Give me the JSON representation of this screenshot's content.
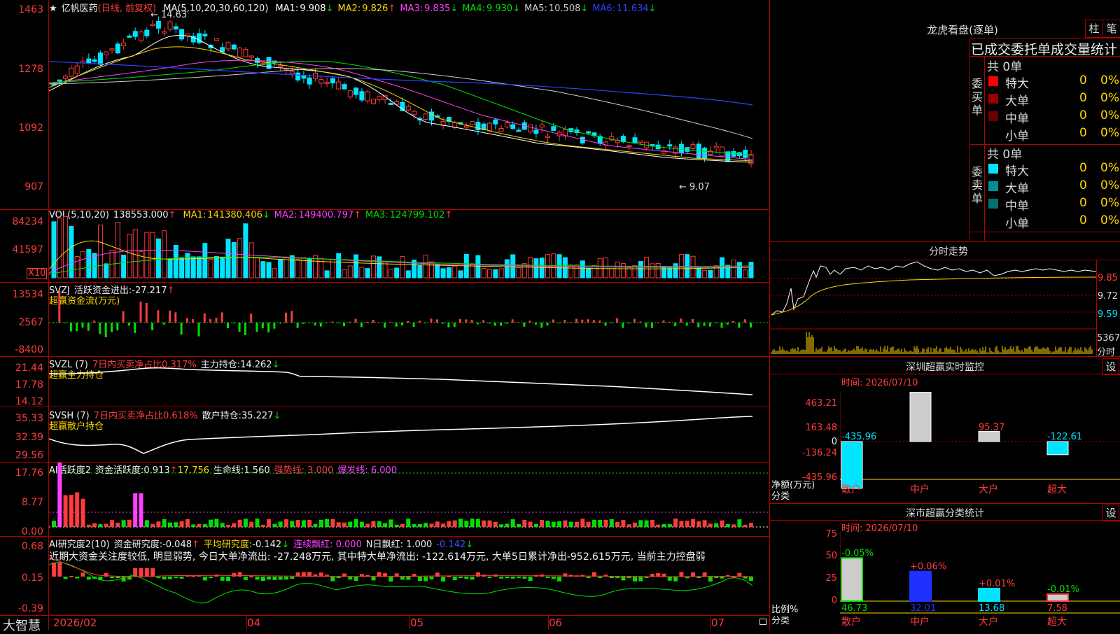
{
  "main": {
    "star": "★",
    "stock_name": "亿帆医药",
    "period": "(日线, 前复权)",
    "ma_label": "MA(5,10,20,30,60,120)",
    "ma": [
      {
        "label": "MA1:",
        "value": "9.908",
        "arrow": "↓",
        "color": "#ffffff"
      },
      {
        "label": "MA2:",
        "value": "9.826",
        "arrow": "↑",
        "color": "#ffd800"
      },
      {
        "label": "MA3:",
        "value": "9.835",
        "arrow": "↓",
        "color": "#ff40ff"
      },
      {
        "label": "MA4:",
        "value": "9.930",
        "arrow": "↓",
        "color": "#00e000"
      },
      {
        "label": "MA5:",
        "value": "10.508",
        "arrow": "↓",
        "color": "#cccccc"
      },
      {
        "label": "MA6:",
        "value": "11.634",
        "arrow": "↓",
        "color": "#3040ff"
      }
    ],
    "y_ticks": [
      "1463",
      "1278",
      "1092",
      "907"
    ],
    "high_label": "14.63",
    "low_label": "9.07"
  },
  "vol": {
    "label": "VOL(5,10,20)",
    "value": "138553.000",
    "value_arrow": "↑",
    "ma": [
      {
        "label": "MA1:",
        "value": "141380.406",
        "arrow": "↓",
        "color": "#ffd800"
      },
      {
        "label": "MA2:",
        "value": "149400.797",
        "arrow": "↑",
        "color": "#ff40ff"
      },
      {
        "label": "MA3:",
        "value": "124799.102",
        "arrow": "↑",
        "color": "#00e000"
      }
    ],
    "y_ticks": [
      "84234",
      "41597"
    ],
    "unit": "X10"
  },
  "svzj": {
    "label": "SVZJ",
    "desc": "活跃资金进出:",
    "value": "-27.217",
    "arrow": "↑",
    "subtitle": "超赢资金流(万元)",
    "y_ticks": [
      "13534",
      "2567",
      "-8400"
    ]
  },
  "svzl": {
    "label": "SVZL (7)",
    "net": "7日内买卖净占比0.317%",
    "desc": "主力持仓:",
    "value": "14.262",
    "arrow": "↓",
    "subtitle": "超赢主力持仓",
    "y_ticks": [
      "21.44",
      "17.78",
      "14.12"
    ]
  },
  "svsh": {
    "label": "SVSH (7)",
    "net": "7日内买卖净占比0.618%",
    "desc": "散户持仓:",
    "value": "35.227",
    "arrow": "↓",
    "subtitle": "超赢散户持仓",
    "y_ticks": [
      "35.33",
      "32.39",
      "29.56"
    ]
  },
  "ai_active": {
    "label": "AI活跃度2",
    "desc": "资金活跃度:",
    "value": "0.913",
    "arrow": "↑",
    "v2": "17.756",
    "life_label": "生命线:",
    "life": "1.560",
    "strong": "强势线: 3.000",
    "burst": "爆发线: 6.000",
    "y_ticks": [
      "17.76",
      "8.77",
      "0.00"
    ]
  },
  "ai_research": {
    "label": "AI研究度2(10)",
    "desc": "资金研究度:",
    "value": "-0.048",
    "arrow": "↑",
    "avg_label": "平均研究度:",
    "avg": "-0.142",
    "avg_arrow": "↓",
    "cont": "连续飘红: 0.000",
    "nday": "N日飘红: 1.000",
    "last": "-0.142",
    "last_arrow": "↓",
    "comment": "近期大资金关注度较低, 明显弱势, 今日大单净流出: -27.248万元, 其中特大单净流出: -122.614万元, 大单5日累计净出-952.615万元, 当前主力控盘弱",
    "y_ticks": [
      "0.68",
      "0.15",
      "-0.39"
    ]
  },
  "xaxis": {
    "logo": "大智慧",
    "labels": [
      "2026/02",
      "04",
      "05",
      "06",
      "07"
    ]
  },
  "lhb": {
    "title": "龙虎看盘(逐单)",
    "btn1": "柱",
    "btn2": "笔",
    "subtitle": "已成交委托单成交量统计",
    "buy_label": "委买单",
    "sell_label": "委卖单",
    "buy_total": "共 0单",
    "sell_total": "共 0单",
    "buy_rows": [
      {
        "name": "特大",
        "count": "0",
        "pct": "0%",
        "color": "#ff0000"
      },
      {
        "name": "大单",
        "count": "0",
        "pct": "0%",
        "color": "#9a0000"
      },
      {
        "name": "中单",
        "count": "0",
        "pct": "0%",
        "color": "#6a0000"
      },
      {
        "name": "小单",
        "count": "0",
        "pct": "0%",
        "color": "#000000"
      }
    ],
    "sell_rows": [
      {
        "name": "特大",
        "count": "0",
        "pct": "0%",
        "color": "#00e5ff"
      },
      {
        "name": "大单",
        "count": "0",
        "pct": "0%",
        "color": "#009090"
      },
      {
        "name": "中单",
        "count": "0",
        "pct": "0%",
        "color": "#007070"
      },
      {
        "name": "小单",
        "count": "0",
        "pct": "0%",
        "color": "#000000"
      }
    ]
  },
  "intraday": {
    "title": "分时走势",
    "y_ticks": [
      "9.85",
      "9.72",
      "9.59"
    ],
    "vol_tick": "5367",
    "vol_unit": "分时"
  },
  "monitor": {
    "title": "深圳超赢实时监控",
    "btn": "设",
    "time": "时间: 2026/07/10",
    "y_ticks": [
      "463.21",
      "163.48",
      "0",
      "-136.24",
      "-435.96"
    ],
    "y_unit": "净额(万元)",
    "x_unit": "分类",
    "categories": [
      "散户",
      "中户",
      "大户",
      "超大"
    ],
    "values": [
      "-435.96",
      "463.21",
      "95.37",
      "-122.61"
    ]
  },
  "classify": {
    "title": "深市超赢分类统计",
    "btn": "设",
    "time": "时间: 2026/07/10",
    "y_ticks": [
      "75",
      "50",
      "25",
      "0"
    ],
    "y_unit": "比例%",
    "x_unit": "分类",
    "categories": [
      "散户",
      "中户",
      "大户",
      "超大"
    ],
    "changes": [
      "-0.05%",
      "+0.06%",
      "+0.01%",
      "-0.01%"
    ],
    "values": [
      "46.73",
      "32.01",
      "13.68",
      "7.58"
    ]
  }
}
